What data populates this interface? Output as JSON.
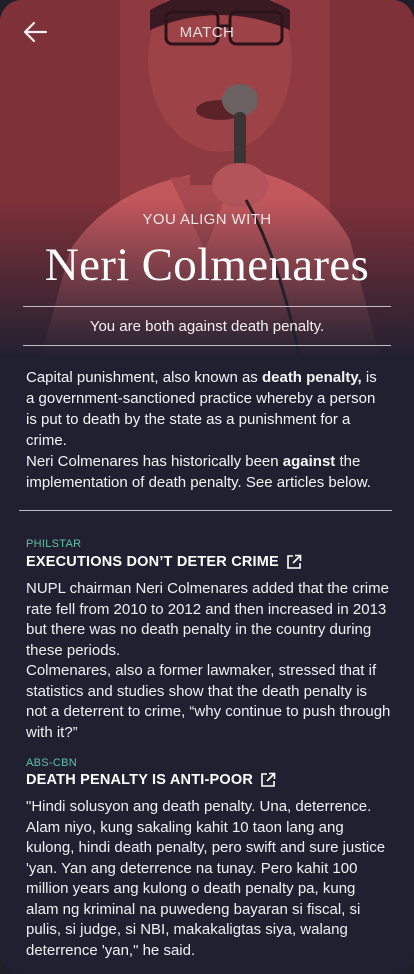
{
  "header": {
    "title": "MATCH",
    "back_icon": "arrow-left-icon"
  },
  "hero": {
    "label": "YOU ALIGN WITH",
    "name": "Neri Colmenares",
    "summary": "You are both against death penalty."
  },
  "intro": {
    "p1_before": "Capital punishment, also known as ",
    "p1_bold": "death penalty,",
    "p1_after": " is a government-sanctioned practice whereby a person is put to death by the state as a punishment for a crime.",
    "p2_before": "Neri Colmenares has historically been ",
    "p2_bold": "against",
    "p2_after": " the implementation of death penalty. See articles below."
  },
  "articles": [
    {
      "source": "PHILSTAR",
      "headline": "EXECUTIONS DON’T DETER CRIME",
      "paragraphs": [
        "NUPL chairman Neri Colmenares added that the crime rate fell from 2010 to 2012 and then increased in 2013 but there was no death penalty in the country during these periods.",
        "Colmenares, also a former lawmaker, stressed that if statistics and studies show that the death penalty is not a deterrent to crime, “why continue to push through with it?”"
      ]
    },
    {
      "source": "ABS-CBN",
      "headline": "DEATH PENALTY IS ANTI-POOR",
      "paragraphs": [
        "\"Hindi solusyon ang death penalty. Una, deterrence. Alam niyo, kung sakaling kahit 10 taon lang ang kulong, hindi death penalty, pero swift and sure justice 'yan. Yan ang deterrence na tunay. Pero kahit 100 million years ang kulong o death penalty pa, kung alam ng kriminal na puwedeng bayaran si fiscal, si pulis, si judge, si NBI, makakaligtas siya, walang deterrence 'yan,\" he said."
      ]
    }
  ],
  "colors": {
    "accent": "#5ec2a8",
    "hero_red": "#9b3f45",
    "background": "#202030"
  }
}
